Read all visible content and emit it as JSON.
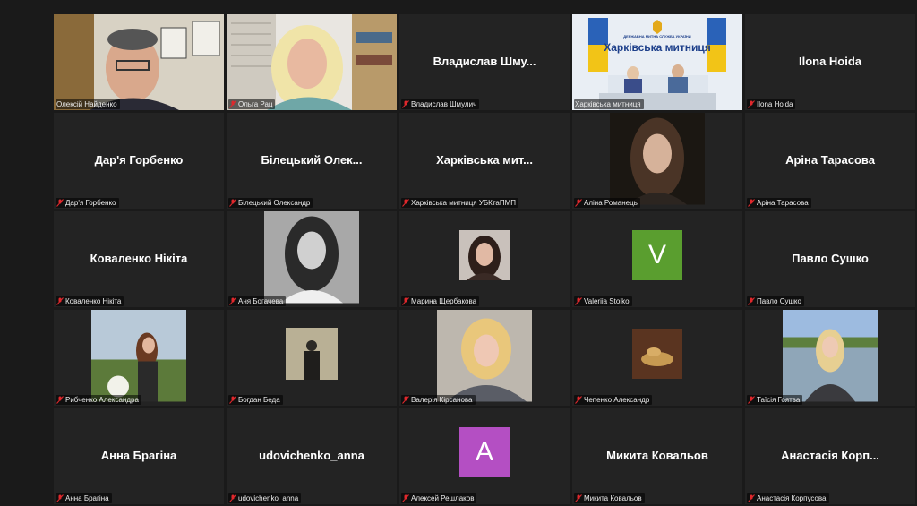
{
  "participants": [
    {
      "label": "Олексій Найденко"
    },
    {
      "label": "Ольга Рац"
    },
    {
      "label": "Владислав Шмулич",
      "display": "Владислав Шму..."
    },
    {
      "label": "Харківська митниця",
      "banner": "Харківська митниця",
      "banner_small": "ДЕРЖАВНА МИТНА СЛУЖБА УКРАЇНИ"
    },
    {
      "label": "Ilona Hoida",
      "display": "Ilona Hoida"
    },
    {
      "label": "Дар'я Горбенко",
      "display": "Дар'я Горбенко"
    },
    {
      "label": "Білецький Олександр",
      "display": "Білецький Олек..."
    },
    {
      "label": "Харківська митниця УБКтаПМП",
      "display": "Харківська мит..."
    },
    {
      "label": "Аліна Романець"
    },
    {
      "label": "Аріна Тарасова",
      "display": "Аріна Тарасова"
    },
    {
      "label": "Коваленко Нікіта",
      "display": "Коваленко Нікіта"
    },
    {
      "label": "Аня Богачева"
    },
    {
      "label": "Марина Щербакова"
    },
    {
      "label": "Valeriia Stoiko",
      "avatar": "V",
      "avatar_color": "#5a9e2f"
    },
    {
      "label": "Павло Сушко",
      "display": "Павло Сушко"
    },
    {
      "label": "Рибченко Александра"
    },
    {
      "label": "Богдан Беда"
    },
    {
      "label": "Валерія Кірсанова"
    },
    {
      "label": "Чепенко Александр"
    },
    {
      "label": "Таїсія Гоятва"
    },
    {
      "label": "Анна Брагіна",
      "display": "Анна Брагіна"
    },
    {
      "label": "udovichenko_anna",
      "display": "udovichenko_anna"
    },
    {
      "label": "Алексей Решлаков",
      "avatar": "A",
      "avatar_color": "#b44fc3"
    },
    {
      "label": "Микита Ковальов",
      "display": "Микита Ковальов"
    },
    {
      "label": "Анастасія Корпусова",
      "display": "Анастасія Корп..."
    }
  ],
  "colors": {
    "active_border": "#c8d94a",
    "muted_mic": "#e0282c",
    "tile_bg": "#232323"
  }
}
